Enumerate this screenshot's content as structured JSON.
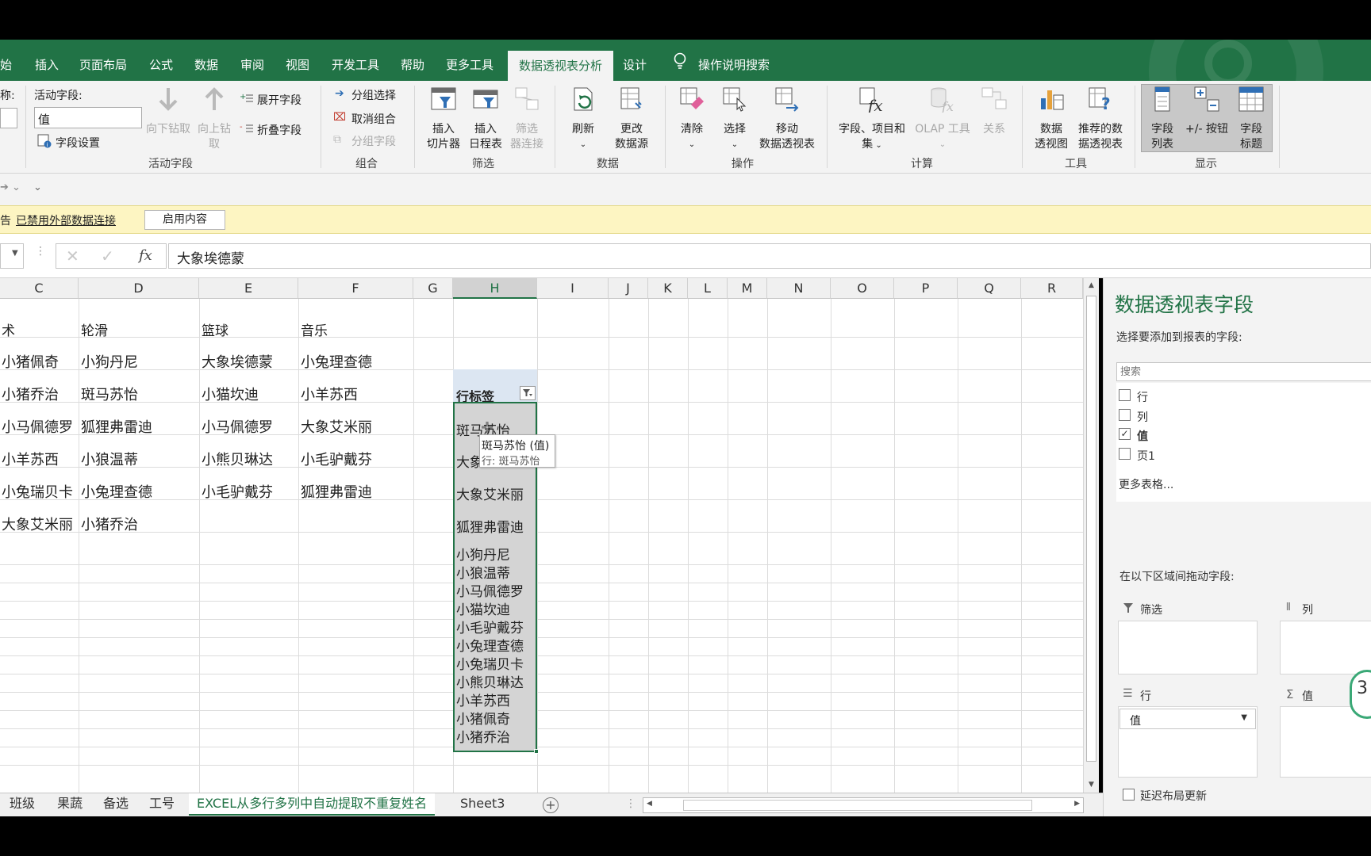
{
  "ribbon_tabs": {
    "start": "始",
    "insert": "插入",
    "page_layout": "页面布局",
    "formula": "公式",
    "data": "数据",
    "review": "审阅",
    "view": "视图",
    "developer": "开发工具",
    "help": "帮助",
    "more_tools": "更多工具",
    "pivot_analyze": "数据透视表分析",
    "design": "设计",
    "tell_me": "操作说明搜索"
  },
  "ribbon": {
    "name_label": "称:",
    "active_field_label": "活动字段:",
    "active_field_value": "值",
    "field_settings": "字段设置",
    "drill_down": "向下钻取",
    "drill_up_1": "向上钻",
    "drill_up_2": "取",
    "expand_field": "展开字段",
    "collapse_field": "折叠字段",
    "group_active_field": "活动字段",
    "group_selection": "分组选择",
    "ungroup": "取消组合",
    "group_field": "分组字段",
    "group_group": "组合",
    "insert_slicer_1": "插入",
    "insert_slicer_2": "切片器",
    "insert_timeline_1": "插入",
    "insert_timeline_2": "日程表",
    "filter_conn_1": "筛选",
    "filter_conn_2": "器连接",
    "group_filter": "筛选",
    "refresh": "刷新",
    "change_source_1": "更改",
    "change_source_2": "数据源",
    "group_data": "数据",
    "clear": "清除",
    "select": "选择",
    "move_1": "移动",
    "move_2": "数据透视表",
    "group_actions": "操作",
    "fields_items_1": "字段、项目和",
    "fields_items_2": "集",
    "olap": "OLAP 工具",
    "relations": "关系",
    "group_calc": "计算",
    "pivot_chart_1": "数据",
    "pivot_chart_2": "透视图",
    "recommended_1": "推荐的数",
    "recommended_2": "据透视表",
    "group_tools": "工具",
    "field_list_1": "字段",
    "field_list_2": "列表",
    "buttons": "+/- 按钮",
    "field_headers_1": "字段",
    "field_headers_2": "标题",
    "group_show": "显示"
  },
  "message_bar": {
    "prefix": "告",
    "text": "已禁用外部数据连接",
    "button": "启用内容"
  },
  "formula_bar": {
    "fx": "fx",
    "value": "大象埃德蒙"
  },
  "columns": [
    "C",
    "D",
    "E",
    "F",
    "G",
    "H",
    "I",
    "J",
    "K",
    "L",
    "M",
    "N",
    "O",
    "P",
    "Q",
    "R"
  ],
  "table": {
    "headers": [
      "术",
      "轮滑",
      "篮球",
      "音乐"
    ],
    "rows": [
      [
        "小猪佩奇",
        "小狗丹尼",
        "大象埃德蒙",
        "小兔理查德"
      ],
      [
        "小猪乔治",
        "斑马苏怡",
        "小猫坎迪",
        "小羊苏西"
      ],
      [
        "小马佩德罗",
        "狐狸弗雷迪",
        "小马佩德罗",
        "大象艾米丽"
      ],
      [
        "小羊苏西",
        "小狼温蒂",
        "小熊贝琳达",
        "小毛驴戴芬"
      ],
      [
        "小兔瑞贝卡",
        "小兔理查德",
        "小毛驴戴芬",
        "狐狸弗雷迪"
      ],
      [
        "大象艾米丽",
        "小猪乔治",
        "",
        ""
      ]
    ]
  },
  "pivot": {
    "header": "行标签",
    "items_spaced": [
      "斑马苏怡",
      "大象",
      "大象艾米丽",
      "狐狸弗雷迪"
    ],
    "items_compact": [
      "小狗丹尼",
      "小狼温蒂",
      "小马佩德罗",
      "小猫坎迪",
      "小毛驴戴芬",
      "小兔理查德",
      "小兔瑞贝卡",
      "小熊贝琳达",
      "小羊苏西",
      "小猪佩奇",
      "小猪乔治"
    ],
    "tooltip_line1": "斑马苏怡 (值)",
    "tooltip_line2": "行: 斑马苏怡"
  },
  "pane": {
    "title": "数据透视表字段",
    "subtitle": "选择要添加到报表的字段:",
    "search_placeholder": "搜索",
    "fields": [
      {
        "label": "行",
        "checked": false
      },
      {
        "label": "列",
        "checked": false
      },
      {
        "label": "值",
        "checked": true
      },
      {
        "label": "页1",
        "checked": false
      }
    ],
    "more_tables": "更多表格...",
    "drag_hint": "在以下区域间拖动字段:",
    "area_filter": "筛选",
    "area_columns": "列",
    "area_rows": "行",
    "area_values": "值",
    "rows_item": "值",
    "defer_update": "延迟布局更新",
    "badge": "3"
  },
  "sheet_tabs": [
    "班级",
    "果蔬",
    "备选",
    "工号",
    "EXCEL从多行多列中自动提取不重复姓名",
    "Sheet3"
  ],
  "active_sheet_index": 4
}
